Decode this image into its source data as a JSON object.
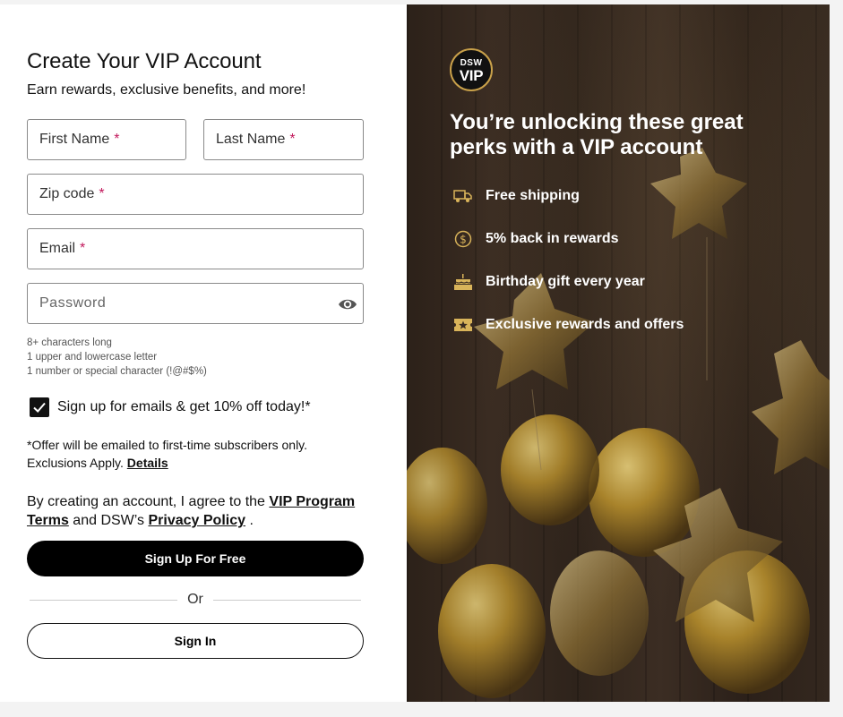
{
  "form": {
    "title": "Create Your VIP Account",
    "subtitle": "Earn rewards, exclusive benefits, and more!",
    "first_name_placeholder": "First Name",
    "last_name_placeholder": "Last Name",
    "zip_placeholder": "Zip code",
    "email_placeholder": "Email",
    "password_placeholder": "Password",
    "required_mark": "*",
    "password_hints": [
      "8+ characters long",
      "1 upper and lowercase letter",
      "1 number or special character (!@#$%)"
    ],
    "email_optin_label": "Sign up for emails & get 10% off today!*",
    "email_optin_checked": true,
    "offer_text_1": "*Offer will be emailed to first-time subscribers only.",
    "offer_text_2": "Exclusions Apply.",
    "offer_details_link": "Details",
    "terms_prefix": "By creating an account, I agree to the",
    "terms_link_vip": "VIP Program Terms",
    "terms_middle": "and DSW’s",
    "terms_link_privacy": "Privacy Policy",
    "terms_suffix": ".",
    "signup_button": "Sign Up For Free",
    "or_label": "Or",
    "signin_button": "Sign In"
  },
  "promo": {
    "logo_line1": "DSW",
    "logo_line2": "VIP",
    "heading": "You’re unlocking these great perks with a VIP account",
    "perks": [
      {
        "icon": "truck-icon",
        "label": "Free shipping"
      },
      {
        "icon": "dollar-coin-icon",
        "label": "5% back in rewards"
      },
      {
        "icon": "birthday-cake-icon",
        "label": "Birthday gift every year"
      },
      {
        "icon": "star-ticket-icon",
        "label": "Exclusive rewards and offers"
      }
    ],
    "accent_color": "#c9a14a"
  },
  "colors": {
    "required": "#c2185b",
    "primary_button": "#000000"
  }
}
